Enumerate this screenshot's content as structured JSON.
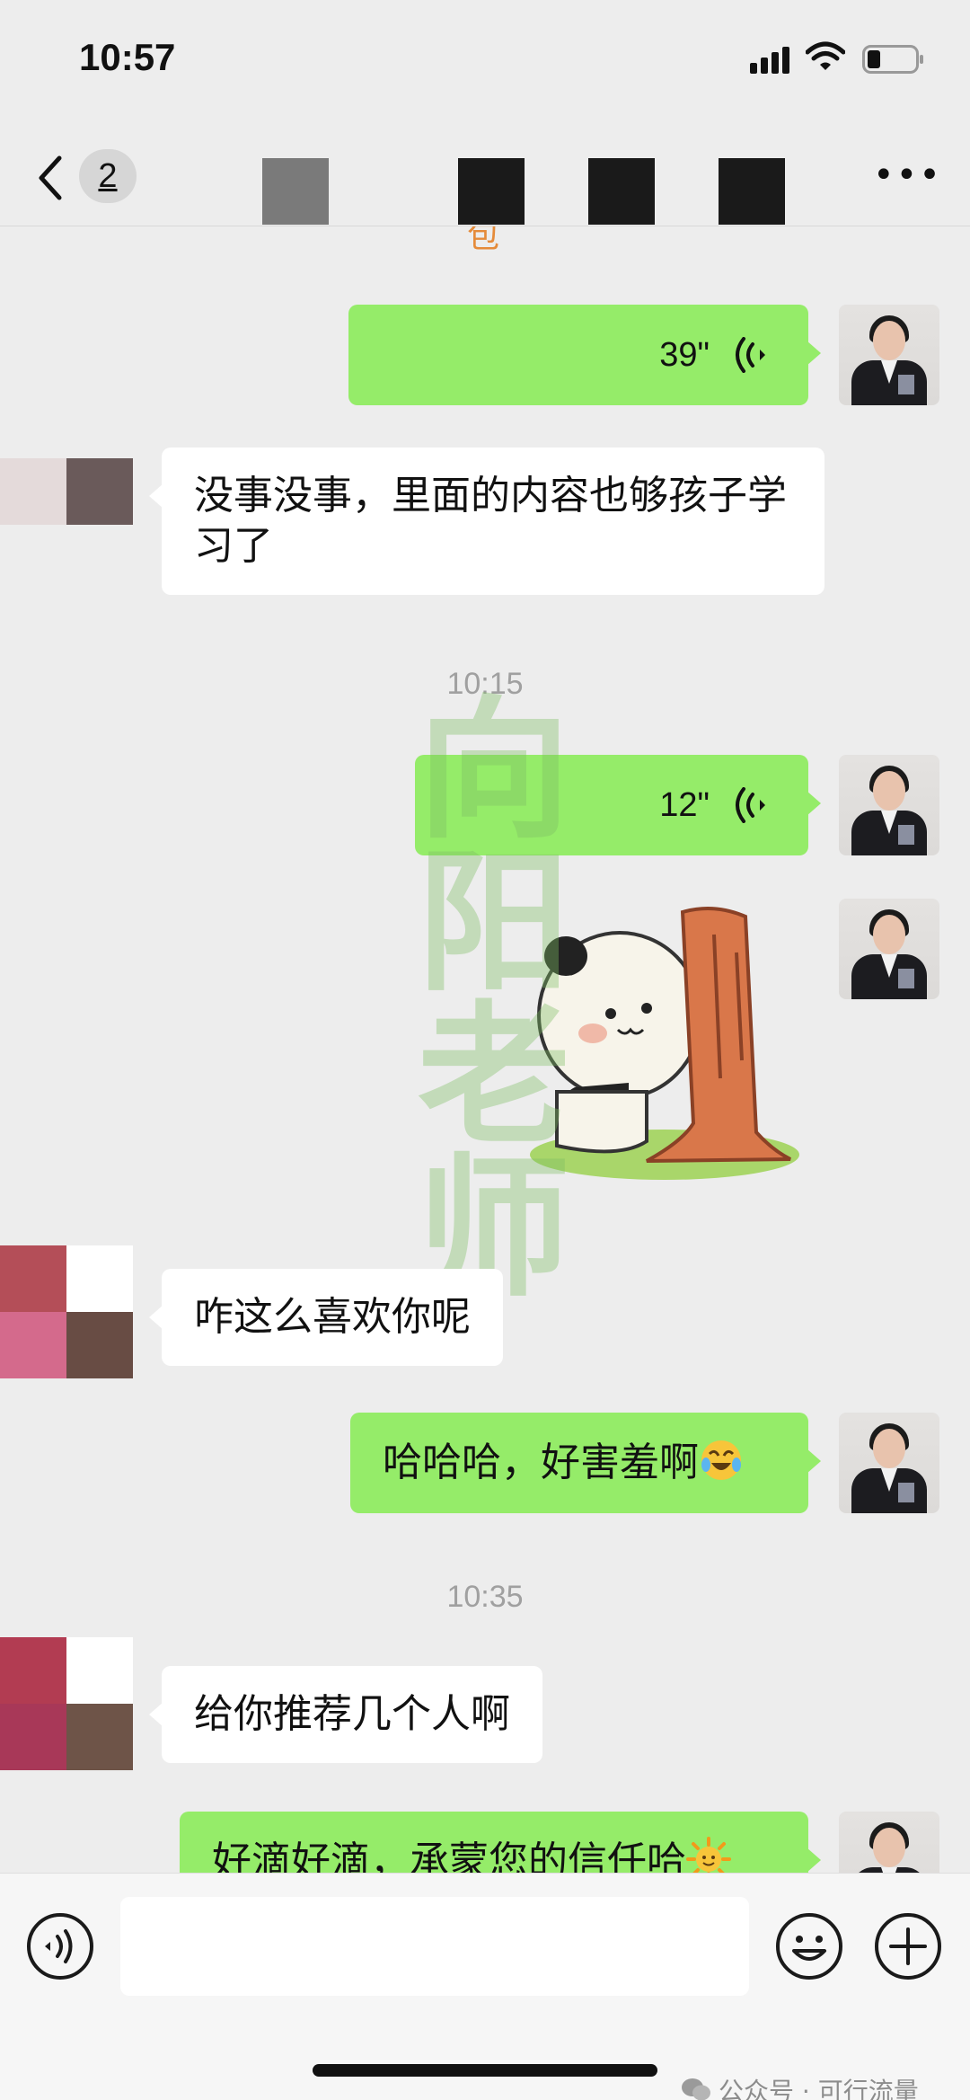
{
  "status_bar": {
    "time": "10:57"
  },
  "nav": {
    "unread_count": "2",
    "more_label": "•••"
  },
  "chat": {
    "cut_text": "包",
    "timestamps": [
      "10:15",
      "10:35"
    ],
    "messages": [
      {
        "from": "self",
        "type": "voice",
        "duration": "39\""
      },
      {
        "from": "other",
        "type": "text",
        "text": "没事没事，里面的内容也够孩子学习了"
      },
      {
        "from": "self",
        "type": "voice",
        "duration": "12\""
      },
      {
        "from": "self",
        "type": "sticker",
        "sticker": "panda-peeking-behind-tree"
      },
      {
        "from": "other",
        "type": "text",
        "text": "咋这么喜欢你呢"
      },
      {
        "from": "self",
        "type": "text",
        "text": "哈哈哈，好害羞啊",
        "emoji": "laughing-crying-emoji"
      },
      {
        "from": "other",
        "type": "text",
        "text": "给你推荐几个人啊"
      },
      {
        "from": "self",
        "type": "text",
        "text": "好滴好滴，承蒙您的信任哈",
        "emoji": "sun-emoji"
      }
    ],
    "watermark": [
      "向",
      "阳",
      "老",
      "师"
    ]
  },
  "footer": {
    "credit": "公众号 · 可行流量"
  },
  "colors": {
    "self_bubble": "#95ec69",
    "other_bubble": "#ffffff",
    "background": "#ededed"
  }
}
